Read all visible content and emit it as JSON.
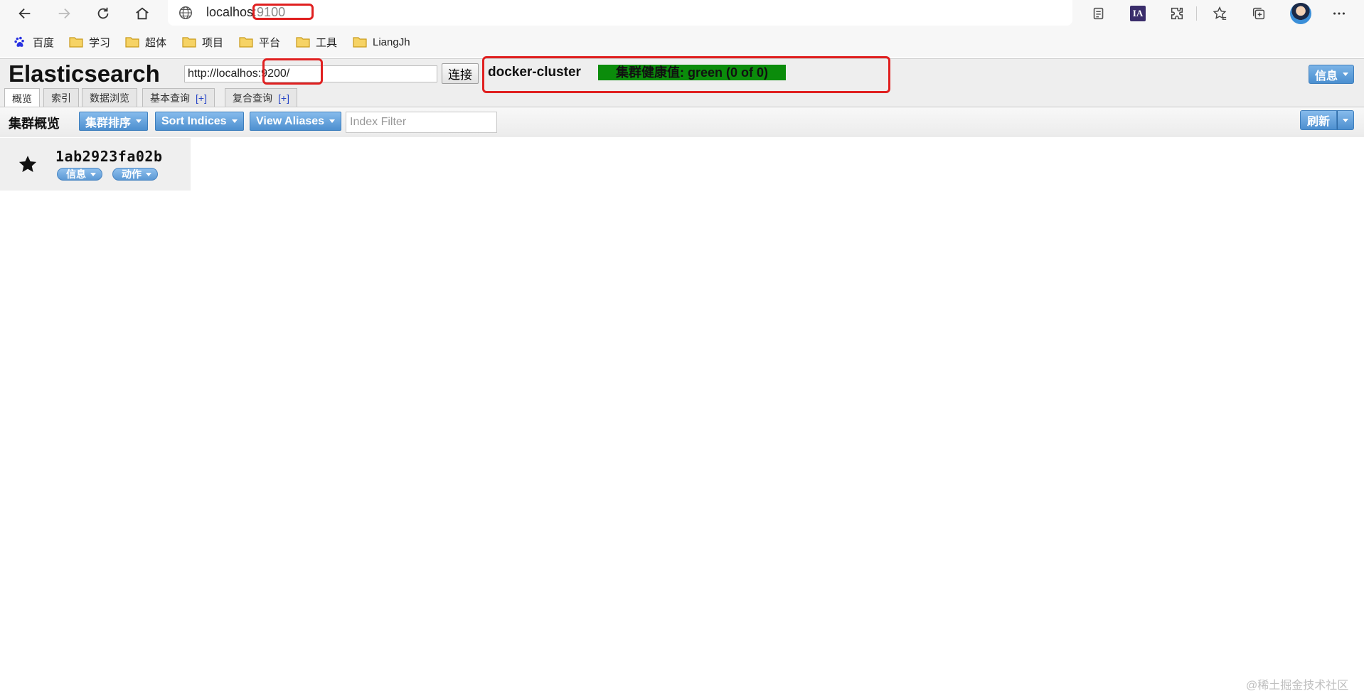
{
  "browser": {
    "address_host": "localhos",
    "address_port": ":9100",
    "bookmarks": [
      "百度",
      "学习",
      "超体",
      "项目",
      "平台",
      "工具",
      "LiangJh"
    ],
    "extension_ia_label": "IA"
  },
  "app": {
    "title": "Elasticsearch",
    "connection_url_prefix": "http://localhos",
    "connection_url_port": ":9200/",
    "connect_button": "连接",
    "cluster_name": "docker-cluster",
    "health_text": "集群健康值: green (0 of 0)",
    "health_color": "#0b8c0b",
    "info_menu": "信息",
    "tabs": [
      {
        "label": "概览",
        "plus": ""
      },
      {
        "label": "索引",
        "plus": ""
      },
      {
        "label": "数据浏览",
        "plus": ""
      },
      {
        "label": "基本查询",
        "plus": "[+]"
      },
      {
        "label": "复合查询",
        "plus": "[+]"
      }
    ],
    "active_tab": "概览"
  },
  "toolbar": {
    "title": "集群概览",
    "cluster_sort": "集群排序",
    "sort_indices": "Sort Indices",
    "view_aliases": "View Aliases",
    "index_filter_placeholder": "Index Filter",
    "refresh": "刷新"
  },
  "node": {
    "name": "1ab2923fa02b",
    "info_button": "信息",
    "action_button": "动作",
    "master_icon": "star-icon"
  },
  "watermark": "@稀土掘金技术社区",
  "colors": {
    "highlight": "#e02020",
    "button_blue": "#4d8fcf"
  }
}
